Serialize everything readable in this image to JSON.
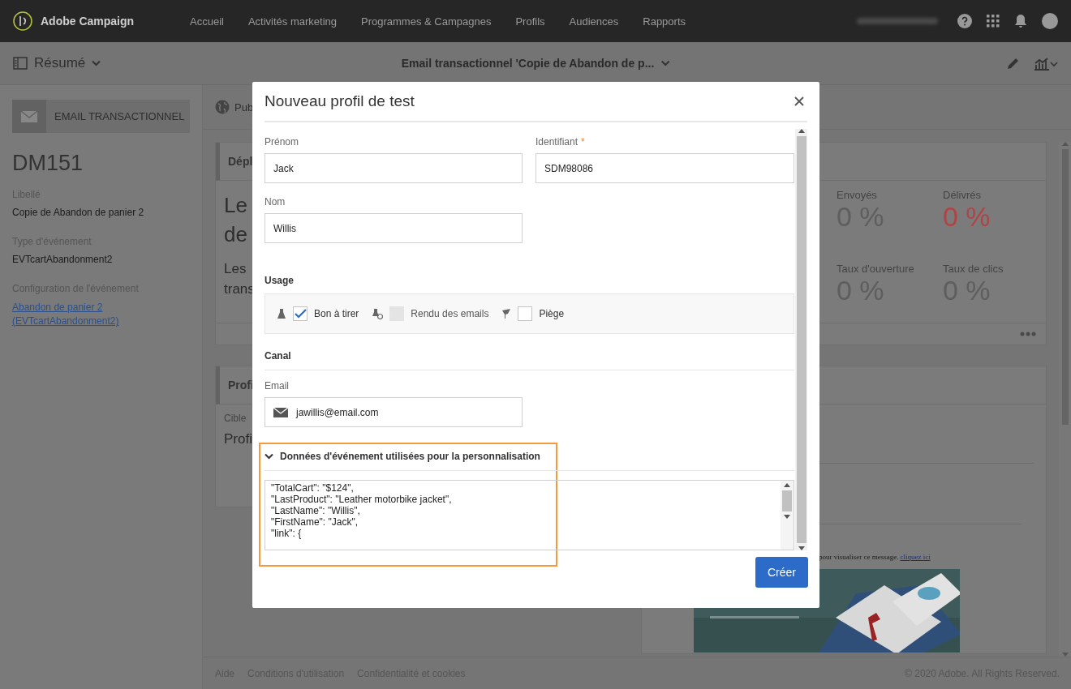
{
  "app": {
    "name": "Adobe Campaign"
  },
  "nav": [
    {
      "label": "Accueil"
    },
    {
      "label": "Activités marketing"
    },
    {
      "label": "Programmes & Campagnes"
    },
    {
      "label": "Profils"
    },
    {
      "label": "Audiences"
    },
    {
      "label": "Rapports"
    }
  ],
  "header": {
    "view": "Résumé",
    "title": "Email transactionnel 'Copie de Abandon de p..."
  },
  "sidebar": {
    "badge": "EMAIL TRANSACTIONNEL",
    "code": "DM151",
    "fields": [
      {
        "label": "Libellé",
        "value": "Copie de Abandon de panier 2",
        "kind": "text"
      },
      {
        "label": "Type d'événement",
        "value": "EVTcartAbandonment2",
        "kind": "text"
      },
      {
        "label": "Configuration de l'événement",
        "value": "Abandon de panier 2 (EVTcartAbandonment2)",
        "kind": "link"
      }
    ]
  },
  "main": {
    "tab": "Pub",
    "deploy_card": {
      "title": "Dépl",
      "headline": [
        "Le",
        "de"
      ],
      "text": [
        "Les",
        "trans"
      ]
    },
    "profile_card": {
      "title": "Profi",
      "label": "Cible",
      "value": "Profi"
    },
    "kpis": [
      {
        "label": "Envoyés",
        "value": "0 %",
        "color": "#5e5e5e"
      },
      {
        "label": "Délivrés",
        "value": "0 %",
        "color": "#b04444"
      },
      {
        "label": "Taux d'ouverture",
        "value": "0 %",
        "color": "#5e5e5e"
      },
      {
        "label": "Taux de clics",
        "value": "0 %",
        "color": "#5e5e5e"
      }
    ],
    "preview": {
      "text": "pour visualiser ce message.",
      "link": "cliquez ici"
    }
  },
  "footer": {
    "links": [
      "Aide",
      "Conditions d'utilisation",
      "Confidentialité et cookies"
    ],
    "copyright": "© 2020 Adobe. All Rights Reserved."
  },
  "modal": {
    "title": "Nouveau profil de test",
    "first_name": {
      "label": "Prénom",
      "value": "Jack"
    },
    "identifier": {
      "label": "Identifiant",
      "required_mark": "*",
      "value": "SDM98086"
    },
    "last_name": {
      "label": "Nom",
      "value": "Willis"
    },
    "usage": {
      "title": "Usage",
      "options": [
        {
          "label": "Bon à tirer",
          "checked": true,
          "disabled": false
        },
        {
          "label": "Rendu des emails",
          "checked": false,
          "disabled": true
        },
        {
          "label": "Piège",
          "checked": false,
          "disabled": false
        }
      ]
    },
    "channel": {
      "title": "Canal",
      "label": "Email",
      "value": "jawillis@email.com"
    },
    "event_data": {
      "title": "Données d'événement utilisées pour la personnalisation",
      "expanded": true,
      "lines": [
        "\"TotalCart\": \"$124\",",
        "\"LastProduct\": \"Leather motorbike jacket\",",
        "\"LastName\": \"Willis\",",
        "\"FirstName\": \"Jack\",",
        "\"link\": {"
      ]
    },
    "submit": "Créer"
  }
}
